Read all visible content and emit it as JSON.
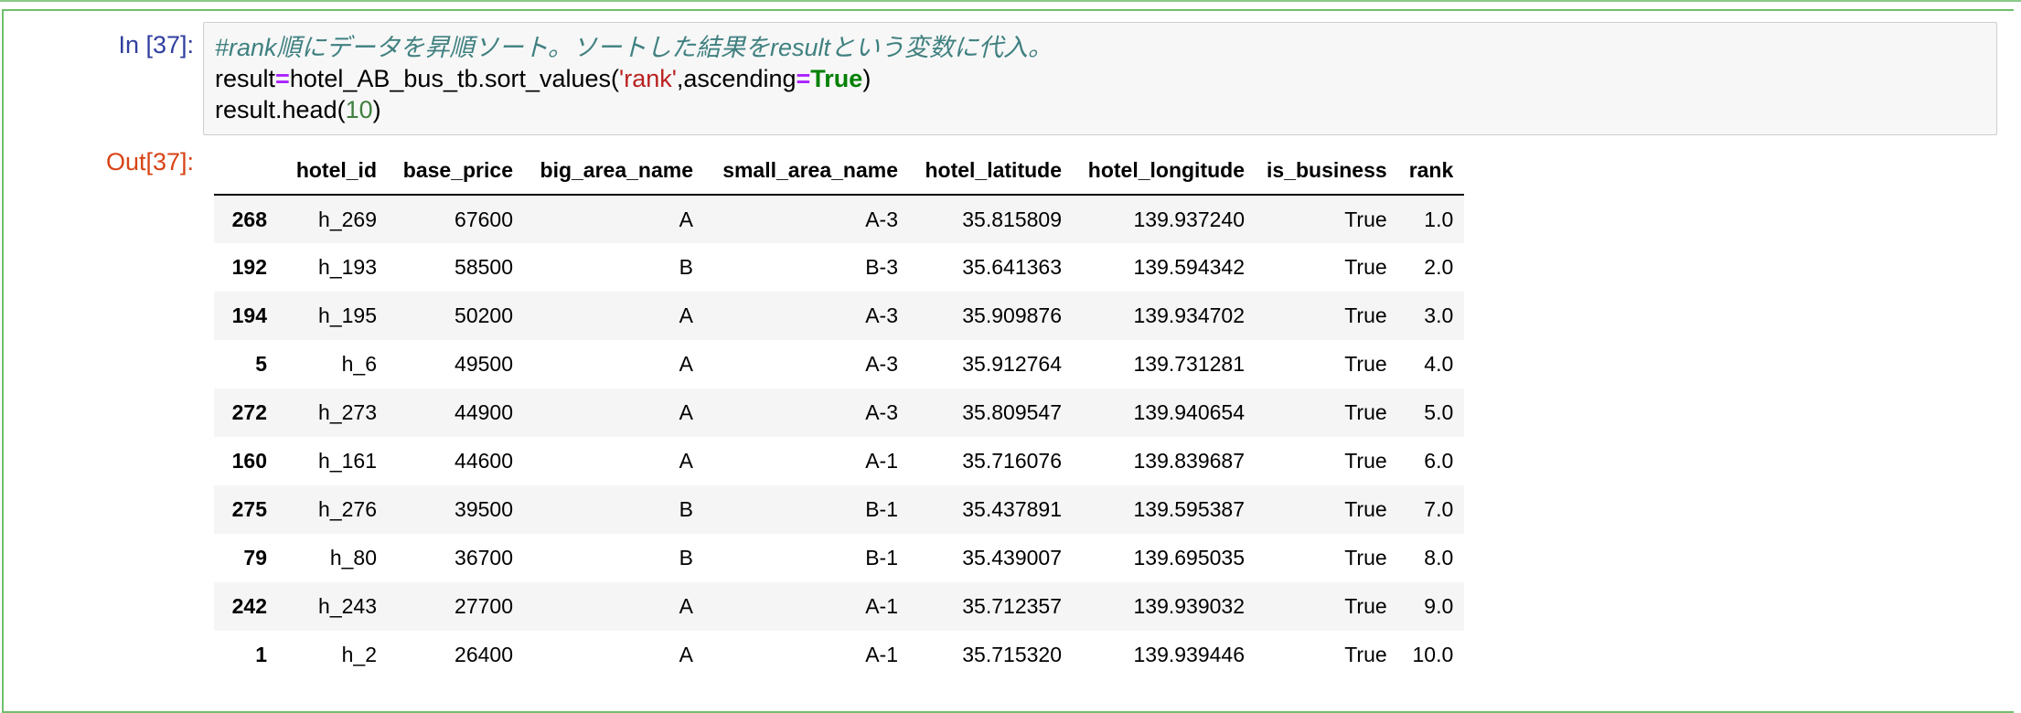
{
  "cell": {
    "in_prompt": "In [37]:",
    "out_prompt": "Out[37]:",
    "code": {
      "comment": "#rank順にデータを昇順ソート。ソートした結果をresultという変数に代入。",
      "line2": {
        "var": "result",
        "assign": "=",
        "call": "hotel_AB_bus_tb.sort_values(",
        "arg_str": "'rank'",
        "sep": ",ascending",
        "kw_assign": "=",
        "kw_val": "True",
        "close": ")"
      },
      "line3": {
        "call": "result.head(",
        "num": "10",
        "close": ")"
      }
    }
  },
  "table": {
    "columns": [
      "",
      "hotel_id",
      "base_price",
      "big_area_name",
      "small_area_name",
      "hotel_latitude",
      "hotel_longitude",
      "is_business",
      "rank"
    ],
    "rows": [
      {
        "index": "268",
        "hotel_id": "h_269",
        "base_price": "67600",
        "big_area_name": "A",
        "small_area_name": "A-3",
        "hotel_latitude": "35.815809",
        "hotel_longitude": "139.937240",
        "is_business": "True",
        "rank": "1.0"
      },
      {
        "index": "192",
        "hotel_id": "h_193",
        "base_price": "58500",
        "big_area_name": "B",
        "small_area_name": "B-3",
        "hotel_latitude": "35.641363",
        "hotel_longitude": "139.594342",
        "is_business": "True",
        "rank": "2.0"
      },
      {
        "index": "194",
        "hotel_id": "h_195",
        "base_price": "50200",
        "big_area_name": "A",
        "small_area_name": "A-3",
        "hotel_latitude": "35.909876",
        "hotel_longitude": "139.934702",
        "is_business": "True",
        "rank": "3.0"
      },
      {
        "index": "5",
        "hotel_id": "h_6",
        "base_price": "49500",
        "big_area_name": "A",
        "small_area_name": "A-3",
        "hotel_latitude": "35.912764",
        "hotel_longitude": "139.731281",
        "is_business": "True",
        "rank": "4.0"
      },
      {
        "index": "272",
        "hotel_id": "h_273",
        "base_price": "44900",
        "big_area_name": "A",
        "small_area_name": "A-3",
        "hotel_latitude": "35.809547",
        "hotel_longitude": "139.940654",
        "is_business": "True",
        "rank": "5.0"
      },
      {
        "index": "160",
        "hotel_id": "h_161",
        "base_price": "44600",
        "big_area_name": "A",
        "small_area_name": "A-1",
        "hotel_latitude": "35.716076",
        "hotel_longitude": "139.839687",
        "is_business": "True",
        "rank": "6.0"
      },
      {
        "index": "275",
        "hotel_id": "h_276",
        "base_price": "39500",
        "big_area_name": "B",
        "small_area_name": "B-1",
        "hotel_latitude": "35.437891",
        "hotel_longitude": "139.595387",
        "is_business": "True",
        "rank": "7.0"
      },
      {
        "index": "79",
        "hotel_id": "h_80",
        "base_price": "36700",
        "big_area_name": "B",
        "small_area_name": "B-1",
        "hotel_latitude": "35.439007",
        "hotel_longitude": "139.695035",
        "is_business": "True",
        "rank": "8.0"
      },
      {
        "index": "242",
        "hotel_id": "h_243",
        "base_price": "27700",
        "big_area_name": "A",
        "small_area_name": "A-1",
        "hotel_latitude": "35.712357",
        "hotel_longitude": "139.939032",
        "is_business": "True",
        "rank": "9.0"
      },
      {
        "index": "1",
        "hotel_id": "h_2",
        "base_price": "26400",
        "big_area_name": "A",
        "small_area_name": "A-1",
        "hotel_latitude": "35.715320",
        "hotel_longitude": "139.939446",
        "is_business": "True",
        "rank": "10.0"
      }
    ]
  },
  "colors": {
    "in_prompt": "#303f9f",
    "out_prompt": "#d84315",
    "cell_border": "#6fbf6b"
  }
}
